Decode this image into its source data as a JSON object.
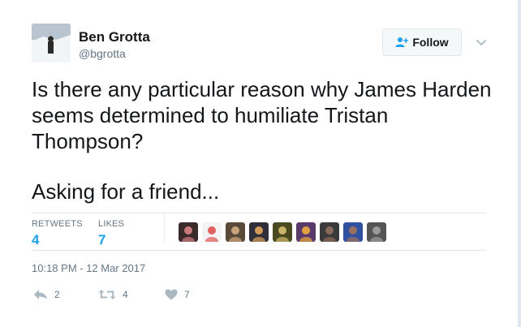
{
  "user": {
    "name": "Ben Grotta",
    "handle": "@bgrotta"
  },
  "follow_button": {
    "label": "Follow",
    "icon": "add-user-icon"
  },
  "tweet": {
    "paragraphs": [
      "Is there any particular reason why James Harden\nseems determined to humiliate Tristan\nThompson?",
      "Asking for a friend..."
    ]
  },
  "stats": {
    "retweets": {
      "label": "RETWEETS",
      "value": "4"
    },
    "likes": {
      "label": "LIKES",
      "value": "7"
    }
  },
  "liker_avatars": [
    {
      "color": "#3a2a2a",
      "accent": "#c97a7a"
    },
    {
      "color": "#f4f4f4",
      "accent": "#e06060"
    },
    {
      "color": "#5a4a3a",
      "accent": "#c8a37a"
    },
    {
      "color": "#2f2f3a",
      "accent": "#d49a5a"
    },
    {
      "color": "#4a4a20",
      "accent": "#c9b26a"
    },
    {
      "color": "#5a3a6a",
      "accent": "#e2a040"
    },
    {
      "color": "#3a3a3a",
      "accent": "#8a6a5a"
    },
    {
      "color": "#3050a0",
      "accent": "#9a7060"
    },
    {
      "color": "#555555",
      "accent": "#9a9a9a"
    }
  ],
  "timestamp": "10:18 PM - 12 Mar 2017",
  "actions": {
    "reply_count": "2",
    "retweet_count": "4",
    "like_count": "7"
  },
  "colors": {
    "link_blue": "#1da1f2",
    "muted_gray": "#657786",
    "border": "#e1e8ed"
  }
}
